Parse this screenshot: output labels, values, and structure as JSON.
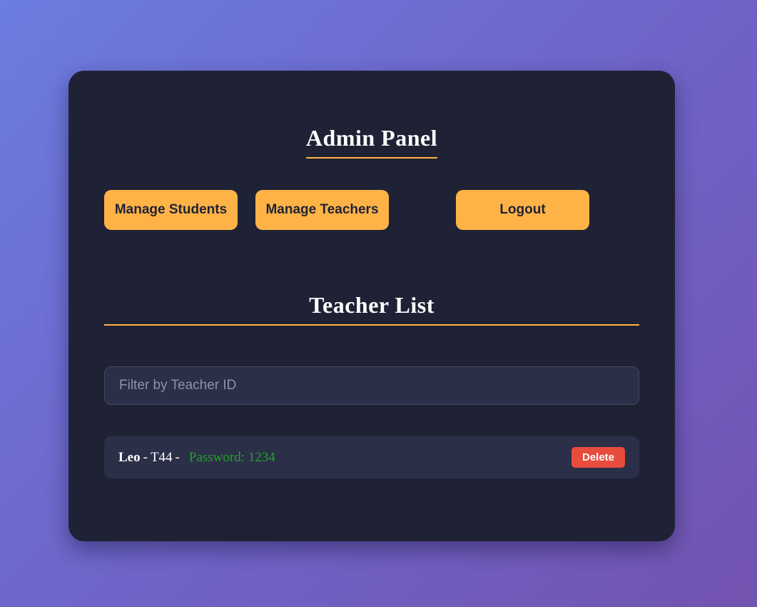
{
  "header": {
    "title": "Admin Panel"
  },
  "nav": {
    "manage_students": "Manage Students",
    "manage_teachers": "Manage Teachers",
    "logout": "Logout"
  },
  "teacher_list": {
    "heading": "Teacher List",
    "filter": {
      "placeholder": "Filter by Teacher ID",
      "value": ""
    },
    "rows": [
      {
        "name": "Leo",
        "separator_1": "-",
        "id": "T44",
        "separator_2": "-",
        "password": "Password: 1234",
        "delete_label": "Delete"
      }
    ]
  },
  "colors": {
    "accent": "#ffb347",
    "panel": "#1f2235",
    "row_bg": "#2c2f48",
    "delete": "#e74c3c",
    "password_text": "#1fa32a"
  }
}
